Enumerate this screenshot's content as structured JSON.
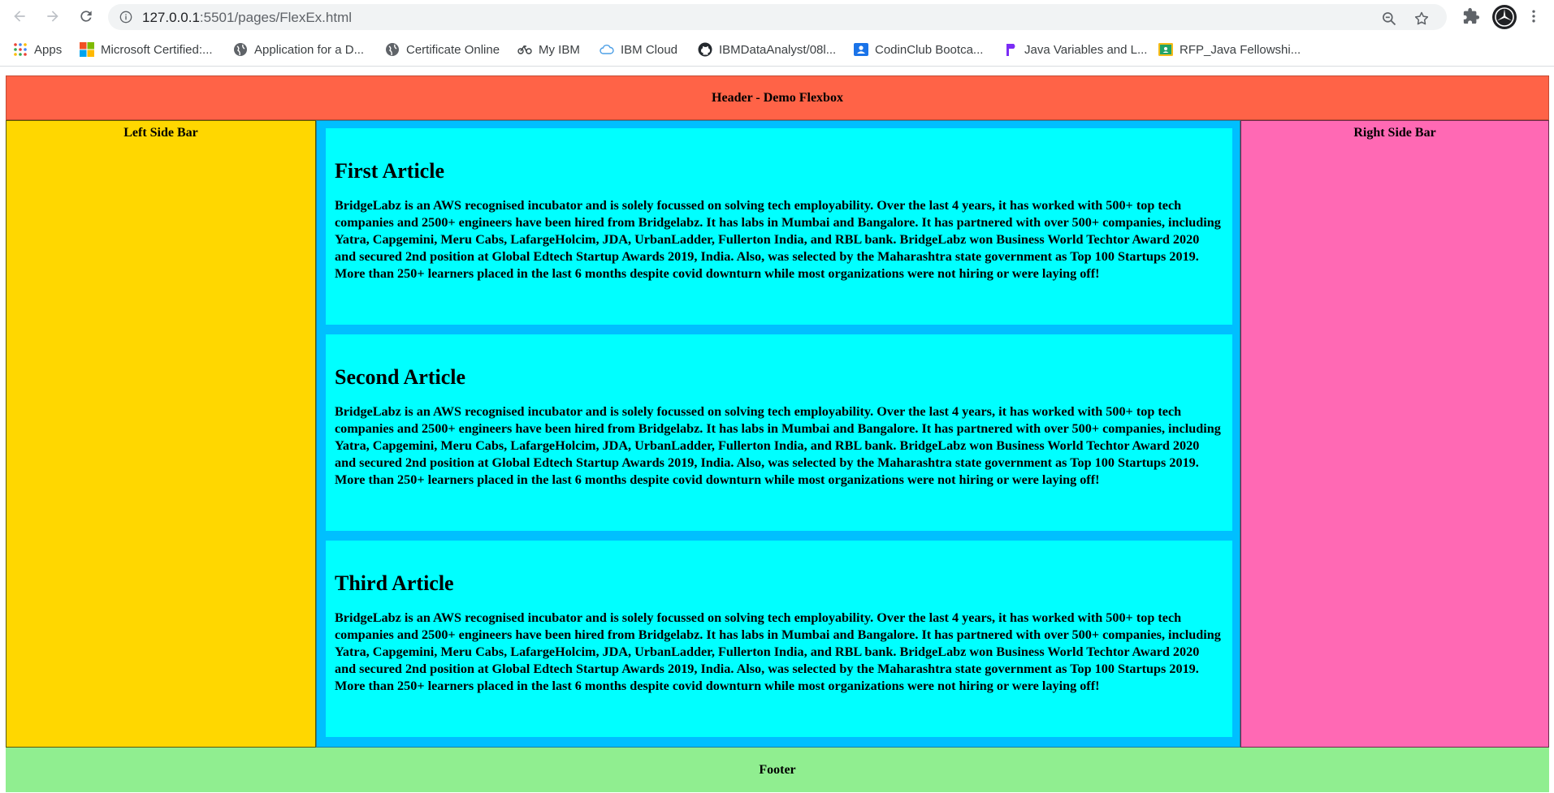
{
  "browser": {
    "url_host": "127.0.0.1",
    "url_rest": ":5501/pages/FlexEx.html",
    "bookmarks": [
      {
        "label": "Apps",
        "icon": "apps-grid-icon"
      },
      {
        "label": "Microsoft Certified:...",
        "icon": "microsoft-logo-icon"
      },
      {
        "label": "Application for a D...",
        "icon": "globe-icon"
      },
      {
        "label": "Certificate Online",
        "icon": "globe-icon"
      },
      {
        "label": "My IBM",
        "icon": "ibm-icon"
      },
      {
        "label": "IBM Cloud",
        "icon": "cloud-icon"
      },
      {
        "label": "IBMDataAnalyst/08l...",
        "icon": "github-icon"
      },
      {
        "label": "CodinClub Bootca...",
        "icon": "contact-card-icon"
      },
      {
        "label": "Java Variables and L...",
        "icon": "flag-icon"
      },
      {
        "label": "RFP_Java Fellowshi...",
        "icon": "classroom-icon"
      }
    ]
  },
  "page": {
    "header": "Header - Demo Flexbox",
    "left_sidebar": "Left Side Bar",
    "right_sidebar": "Right Side Bar",
    "footer": "Footer",
    "articles": [
      {
        "title": "First Article",
        "body": "BridgeLabz is an AWS recognised incubator and is solely focussed on solving tech employability. Over the last 4 years, it has worked with 500+ top tech companies and 2500+ engineers have been hired from Bridgelabz. It has labs in Mumbai and Bangalore. It has partnered with over 500+ companies, including Yatra, Capgemini, Meru Cabs, LafargeHolcim, JDA, UrbanLadder, Fullerton India, and RBL bank. BridgeLabz won Business World Techtor Award 2020 and secured 2nd position at Global Edtech Startup Awards 2019, India. Also, was selected by the Maharashtra state government as Top 100 Startups 2019. More than 250+ learners placed in the last 6 months despite covid downturn while most organizations were not hiring or were laying off!"
      },
      {
        "title": "Second Article",
        "body": "BridgeLabz is an AWS recognised incubator and is solely focussed on solving tech employability. Over the last 4 years, it has worked with 500+ top tech companies and 2500+ engineers have been hired from Bridgelabz. It has labs in Mumbai and Bangalore. It has partnered with over 500+ companies, including Yatra, Capgemini, Meru Cabs, LafargeHolcim, JDA, UrbanLadder, Fullerton India, and RBL bank. BridgeLabz won Business World Techtor Award 2020 and secured 2nd position at Global Edtech Startup Awards 2019, India. Also, was selected by the Maharashtra state government as Top 100 Startups 2019. More than 250+ learners placed in the last 6 months despite covid downturn while most organizations were not hiring or were laying off!"
      },
      {
        "title": "Third Article",
        "body": "BridgeLabz is an AWS recognised incubator and is solely focussed on solving tech employability. Over the last 4 years, it has worked with 500+ top tech companies and 2500+ engineers have been hired from Bridgelabz. It has labs in Mumbai and Bangalore. It has partnered with over 500+ companies, including Yatra, Capgemini, Meru Cabs, LafargeHolcim, JDA, UrbanLadder, Fullerton India, and RBL bank. BridgeLabz won Business World Techtor Award 2020 and secured 2nd position at Global Edtech Startup Awards 2019, India. Also, was selected by the Maharashtra state government as Top 100 Startups 2019. More than 250+ learners placed in the last 6 months despite covid downturn while most organizations were not hiring or were laying off!"
      }
    ]
  },
  "colors": {
    "header_bg": "#ff6347",
    "left_sidebar_bg": "#ffd700",
    "main_bg": "#00bfff",
    "article_bg": "#00ffff",
    "right_sidebar_bg": "#ff69b4",
    "footer_bg": "#90ee90"
  }
}
